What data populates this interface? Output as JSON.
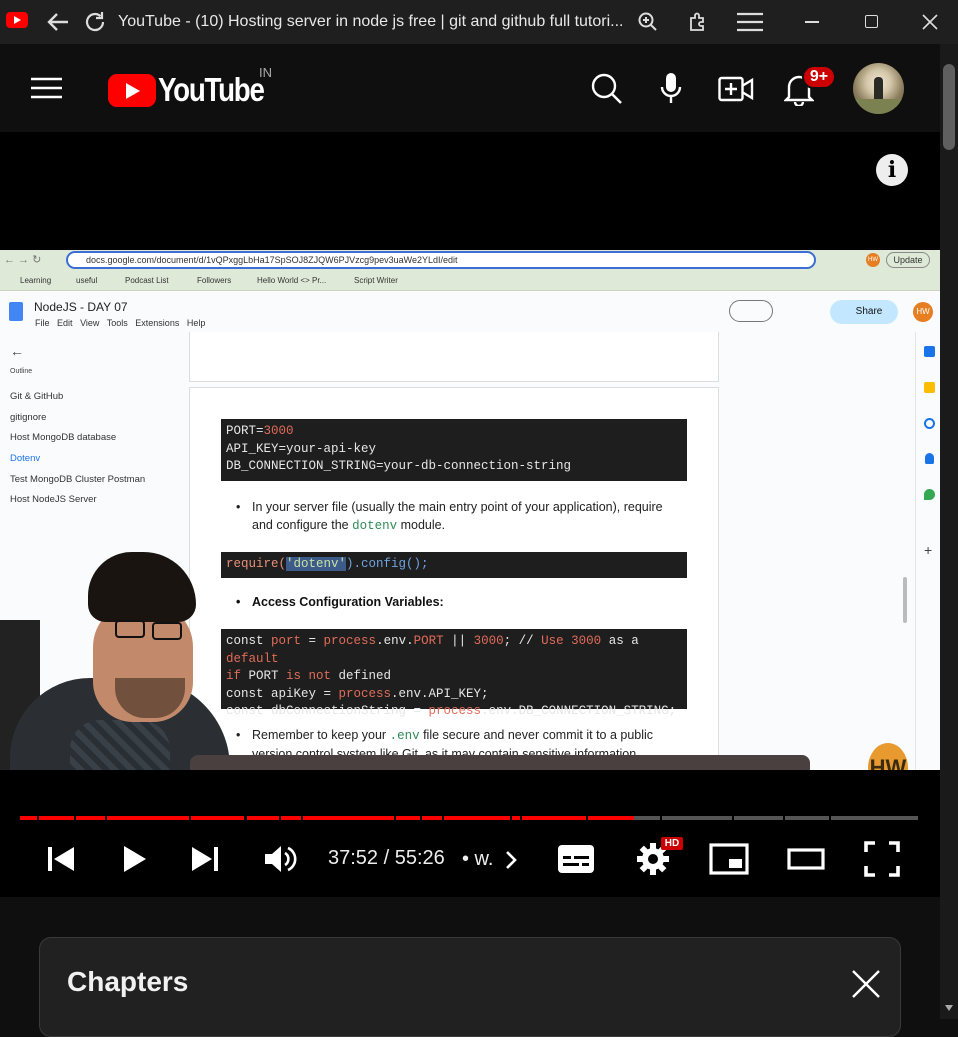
{
  "browser": {
    "title": "YouTube - (10) Hosting server in node js free | git and github full tutori..."
  },
  "youtube": {
    "logo_text": "YouTube",
    "region": "IN",
    "notification_count": "9+"
  },
  "docs_browser": {
    "url": "docs.google.com/document/d/1vQPxggLbHa17SpSOJ8ZJQW6PJVzcg9pev3uaWe2YLdI/edit",
    "update_label": "Update",
    "profile_initials": "HW",
    "bookmarks": [
      "Learning",
      "useful",
      "Podcast List",
      "Followers",
      "Hello World <> Pr...",
      "Script Writer"
    ]
  },
  "doc": {
    "title": "NodeJS - DAY 07",
    "menu": [
      "File",
      "Edit",
      "View",
      "Tools",
      "Extensions",
      "Help"
    ],
    "share_label": "Share",
    "outline_label": "Outline",
    "outline": [
      "Git & GitHub",
      "gitignore",
      "Host MongoDB database",
      "Dotenv",
      "Test MongoDB Cluster Postman",
      "Host NodeJS Server"
    ],
    "code1": {
      "l1_a": "PORT=",
      "l1_b": "3000",
      "l2": "API_KEY=your-api-key",
      "l3": "DB_CONNECTION_STRING=your-db-connection-string"
    },
    "bullet1_a": "In your server file (usually the main entry point of your application), require",
    "bullet1_b": "and configure the",
    "bullet1_code": "dotenv",
    "bullet1_c": "module.",
    "code2": {
      "a": "require(",
      "b": "'dotenv'",
      "c": ").config();"
    },
    "bullet2": "Access Configuration Variables:",
    "code3": {
      "l1_a": "const ",
      "l1_b": "port",
      "l1_c": " = ",
      "l1_d": "process",
      "l1_e": ".env.",
      "l1_f": "PORT",
      "l1_g": " || ",
      "l1_h": "3000",
      "l1_i": "; // ",
      "l1_j": "Use",
      "l1_k": " ",
      "l1_l": "3000",
      "l1_m": " as a ",
      "l1_n": "default",
      "l2_a": "if",
      "l2_b": " PORT ",
      "l2_c": "is not",
      "l2_d": " defined",
      "l3_a": "const apiKey = ",
      "l3_b": "process",
      "l3_c": ".env.API_KEY;",
      "l4_a": "const dbConnectionString = ",
      "l4_b": "process",
      "l4_c": ".env.DB_CONNECTION_STRING;"
    },
    "bullet3_a": "Remember to keep your",
    "bullet3_code": ".env",
    "bullet3_b": "file secure and never commit it to a public",
    "bullet3_c": "version control system like Git, as it may contain sensitive information."
  },
  "channel_watermark": "HW",
  "player": {
    "time": "37:52 / 55:26",
    "chapter": "• w.",
    "progress_fraction": 0.684,
    "quality_badge": "HD"
  },
  "chapters_panel": {
    "title": "Chapters"
  },
  "colors": {
    "yt_red": "#ff0000",
    "progress_red": "#ff0000",
    "docs_blue": "#1a73e8"
  }
}
